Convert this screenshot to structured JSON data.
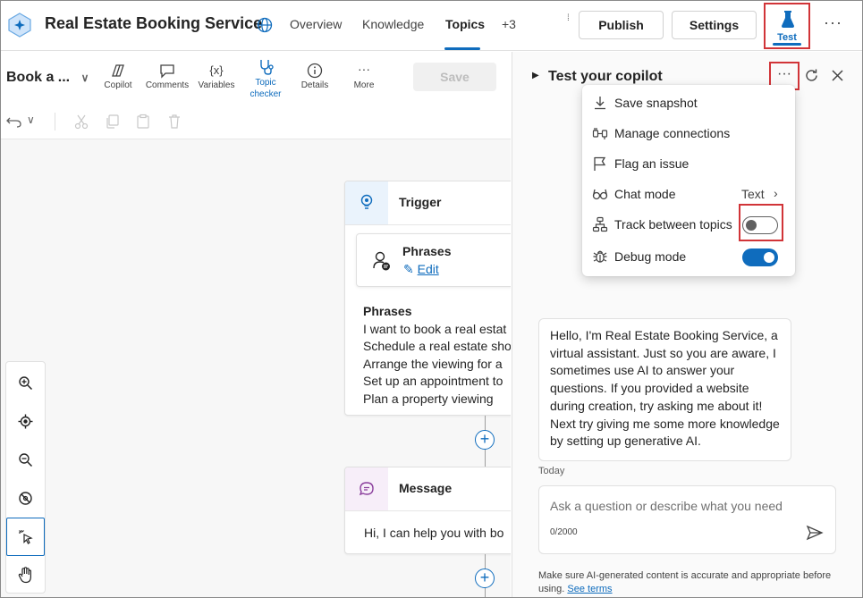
{
  "header": {
    "app_title": "Real Estate Booking Service",
    "tabs": [
      {
        "label": "Overview"
      },
      {
        "label": "Knowledge"
      },
      {
        "label": "Topics"
      },
      {
        "label": "+3"
      }
    ],
    "publish_label": "Publish",
    "settings_label": "Settings",
    "test_label": "Test",
    "more_label": "···"
  },
  "editor": {
    "topic_name": "Book a ...",
    "tools": [
      {
        "label": "Copilot"
      },
      {
        "label": "Comments"
      },
      {
        "label": "Variables"
      },
      {
        "label": "Topic checker"
      },
      {
        "label": "Details"
      },
      {
        "label": "More"
      }
    ],
    "save_label": "Save",
    "trigger": {
      "title": "Trigger",
      "phrases_title": "Phrases",
      "edit_label": "Edit",
      "list_heading": "Phrases",
      "phrases": [
        "I want to book a real estat",
        "Schedule a real estate sho",
        "Arrange the viewing for a",
        "Set up an appointment to",
        "Plan a property viewing"
      ]
    },
    "message": {
      "title": "Message",
      "text": "Hi, I can help you with bo"
    }
  },
  "test_panel": {
    "title": "Test your copilot",
    "menu": {
      "items": [
        {
          "label": "Save snapshot"
        },
        {
          "label": "Manage connections"
        },
        {
          "label": "Flag an issue"
        },
        {
          "label": "Chat mode",
          "value": "Text"
        },
        {
          "label": "Track between topics",
          "toggle": false
        },
        {
          "label": "Debug mode",
          "toggle": true
        }
      ]
    },
    "bot_message": "Hello, I'm Real Estate Booking Service, a virtual assistant. Just so you are aware, I sometimes use AI to answer your questions. If you provided a website during creation, try asking me about it! Next try giving me some more knowledge by setting up generative AI.",
    "date_label": "Today",
    "input_placeholder": "Ask a question or describe what you need",
    "char_count": "0/2000",
    "disclaimer": "Make sure AI-generated content is accurate and appropriate before using.",
    "see_terms": "See terms"
  },
  "colors": {
    "accent": "#0f6cbd",
    "highlight_red": "#d13438"
  }
}
